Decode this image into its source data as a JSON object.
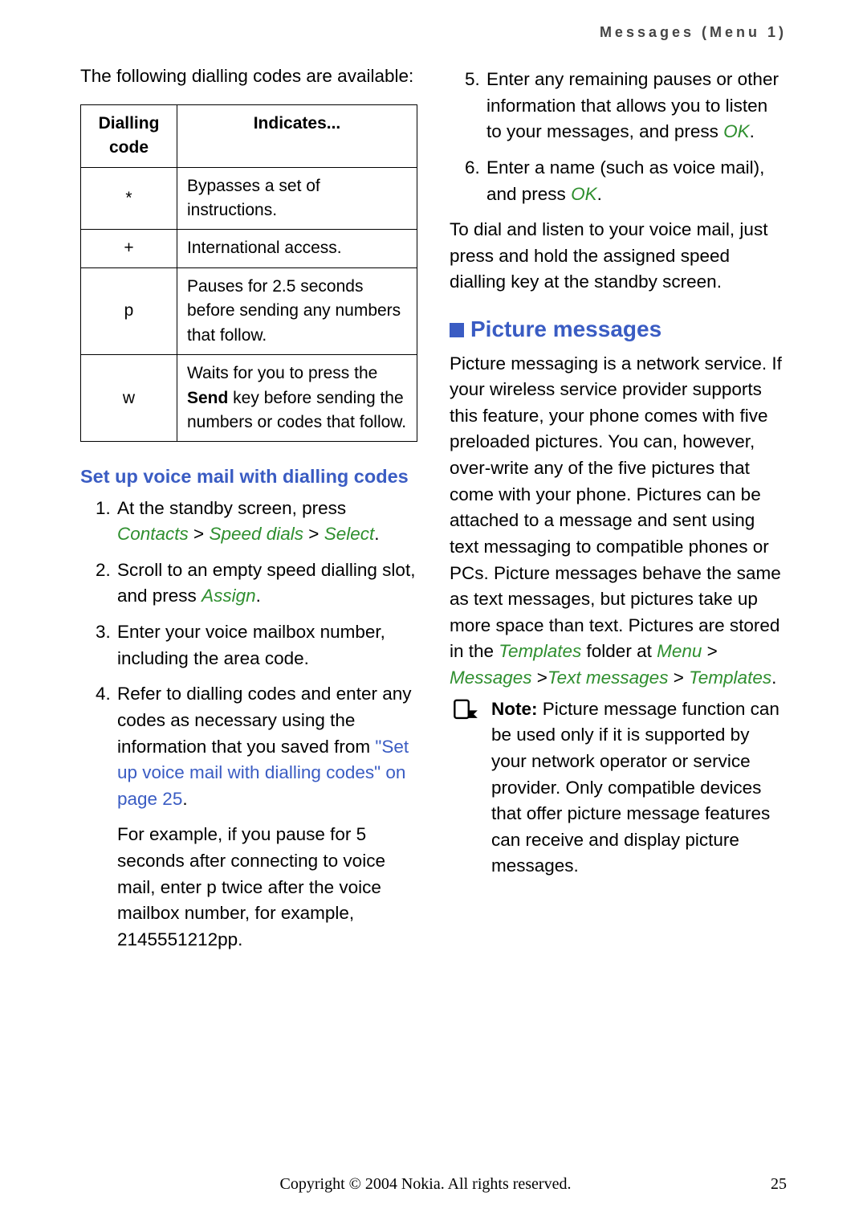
{
  "header": "Messages (Menu 1)",
  "left": {
    "intro": "The following dialling codes are available:",
    "table": {
      "h1": "Dialling code",
      "h2": "Indicates...",
      "rows": [
        {
          "code": "*",
          "desc": "Bypasses a set of instructions."
        },
        {
          "code": "+",
          "desc": "International access."
        },
        {
          "code": "p",
          "desc": "Pauses for 2.5 seconds before sending any numbers that follow."
        },
        {
          "code": "w",
          "desc_pre": "Waits for you to press the ",
          "desc_bold": "Send",
          "desc_post": " key before sending the numbers or codes that follow."
        }
      ]
    },
    "subhead": "Set up voice mail with dialling codes",
    "step1_a": "At the standby screen, press ",
    "step1_contacts": "Contacts",
    "step1_gt1": " > ",
    "step1_speed": "Speed dials",
    "step1_gt2": " > ",
    "step1_select": "Select",
    "step2_a": "Scroll to an empty speed dialling slot, and press ",
    "step2_assign": "Assign",
    "step3": "Enter your voice mailbox number, including the area code.",
    "step4_a": "Refer to dialling codes and enter any codes as necessary using the information that you saved from ",
    "step4_link": "\"Set up voice mail with dialling codes\" on page 25",
    "step4_example": "For example, if you pause for 5 seconds after connecting to voice mail, enter p twice after the voice mailbox number, for example, 2145551212pp."
  },
  "right": {
    "step5_a": "Enter any remaining pauses or other information that allows you to listen to your messages, and press ",
    "ok": "OK",
    "step6_a": "Enter a name (such as voice mail), and press ",
    "para_after": "To dial and listen to your voice mail, just press and hold the assigned speed dialling key at the standby screen.",
    "section": "Picture messages",
    "pm_a": "Picture messaging is a network service. If your wireless service provider supports this feature, your phone comes with five preloaded pictures. You can, however, over-write any of the five pictures that come with your phone. Pictures can be attached to a message and sent using text messaging to compatible phones or PCs. Picture messages behave the same as text messages, but pictures take up more space than text. Pictures are stored in the ",
    "pm_templates": "Templates",
    "pm_b": " folder at ",
    "pm_menu": "Menu",
    "pm_gt": " > ",
    "pm_messages": "Messages",
    "pm_gt2": " >",
    "pm_text": "Text messages",
    "pm_templates2": "Templates",
    "note_label": "Note:",
    "note_body": " Picture message function can be used only if it is supported by your network operator or service provider. Only compatible devices that offer picture message features can receive and display picture messages."
  },
  "footer": {
    "copyright": "Copyright © 2004 Nokia. All rights reserved.",
    "page": "25"
  }
}
